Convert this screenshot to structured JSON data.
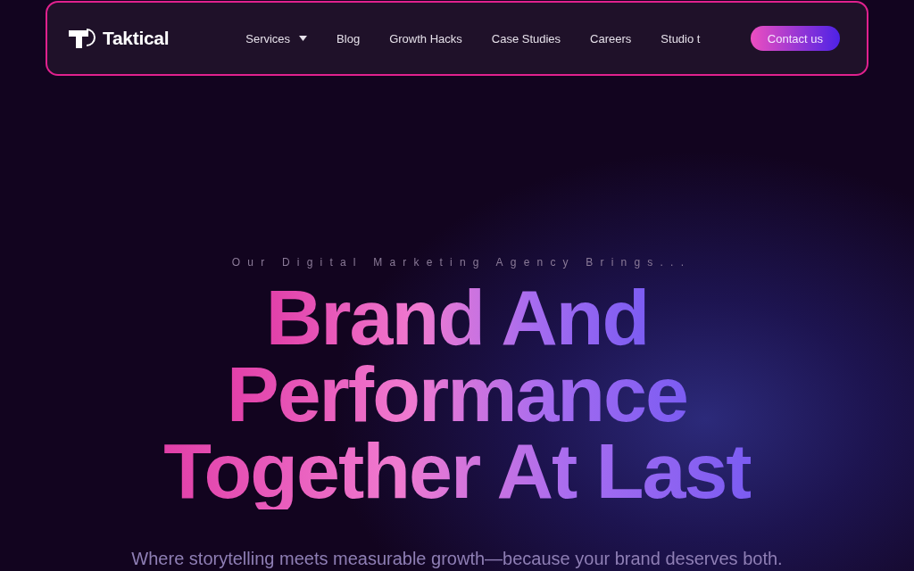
{
  "nav": {
    "logo": "Taktical",
    "links": [
      {
        "label": "Services",
        "dropdown": true
      },
      {
        "label": "Blog",
        "dropdown": false
      },
      {
        "label": "Growth Hacks",
        "dropdown": false
      },
      {
        "label": "Case Studies",
        "dropdown": false
      },
      {
        "label": "Careers",
        "dropdown": false
      },
      {
        "label": "Studio t",
        "dropdown": false
      }
    ],
    "cta": "Contact us"
  },
  "hero": {
    "tagline": "Our Digital Marketing Agency Brings...",
    "headline": [
      "Brand And",
      "Performance",
      "Together At Last"
    ],
    "subtitle": "Where storytelling meets measurable growth—because your brand deserves both."
  }
}
